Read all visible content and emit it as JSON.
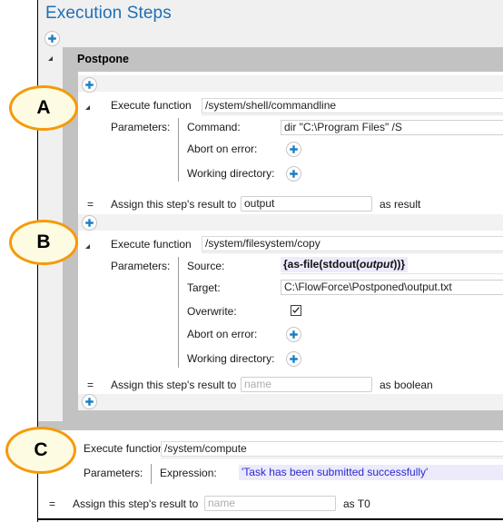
{
  "page": {
    "title": "Execution Steps",
    "accent_blue": "#1f6fb5",
    "panel_gray": "#c2c2c2",
    "callout_border": "#f59a0b",
    "callout_fill": "#fdfbe2",
    "expression_bg": "#eceafb",
    "expression_blue": "#2a2ad0"
  },
  "callouts": [
    {
      "label": "A"
    },
    {
      "label": "B"
    },
    {
      "label": "C"
    }
  ],
  "group": {
    "name": "Postpone"
  },
  "common": {
    "execute_function_label": "Execute function",
    "parameters_label": "Parameters:",
    "assign_label": "Assign this step's result to",
    "as_label": "as",
    "assign_placeholder": "name",
    "add_step_icon": "plus-icon",
    "collapse_icon": "triangle-collapse-icon",
    "equals_sign": "="
  },
  "steps": [
    {
      "id": "step-a",
      "function": "/system/shell/commandline",
      "parameters": [
        {
          "label": "Command:",
          "type": "text",
          "value": "dir \"C:\\Program Files\" /S"
        },
        {
          "label": "Abort on error:",
          "type": "add",
          "value": ""
        },
        {
          "label": "Working directory:",
          "type": "add",
          "value": ""
        }
      ],
      "assign_value": "output",
      "assign_is_placeholder": false,
      "result_type": "result"
    },
    {
      "id": "step-b",
      "function": "/system/filesystem/copy",
      "parameters": [
        {
          "label": "Source:",
          "type": "expression",
          "value": "{as-file(stdout(output))}"
        },
        {
          "label": "Target:",
          "type": "text",
          "value": "C:\\FlowForce\\Postponed\\output.txt"
        },
        {
          "label": "Overwrite:",
          "type": "checkbox",
          "value": "checked"
        },
        {
          "label": "Abort on error:",
          "type": "add",
          "value": ""
        },
        {
          "label": "Working directory:",
          "type": "add",
          "value": ""
        }
      ],
      "assign_value": "name",
      "assign_is_placeholder": true,
      "result_type": "boolean"
    },
    {
      "id": "step-c",
      "function": "/system/compute",
      "parameters": [
        {
          "label": "Expression:",
          "type": "expression-blue",
          "value": "'Task has been submitted successfully'"
        }
      ],
      "assign_value": "name",
      "assign_is_placeholder": true,
      "result_type": "T0"
    }
  ]
}
